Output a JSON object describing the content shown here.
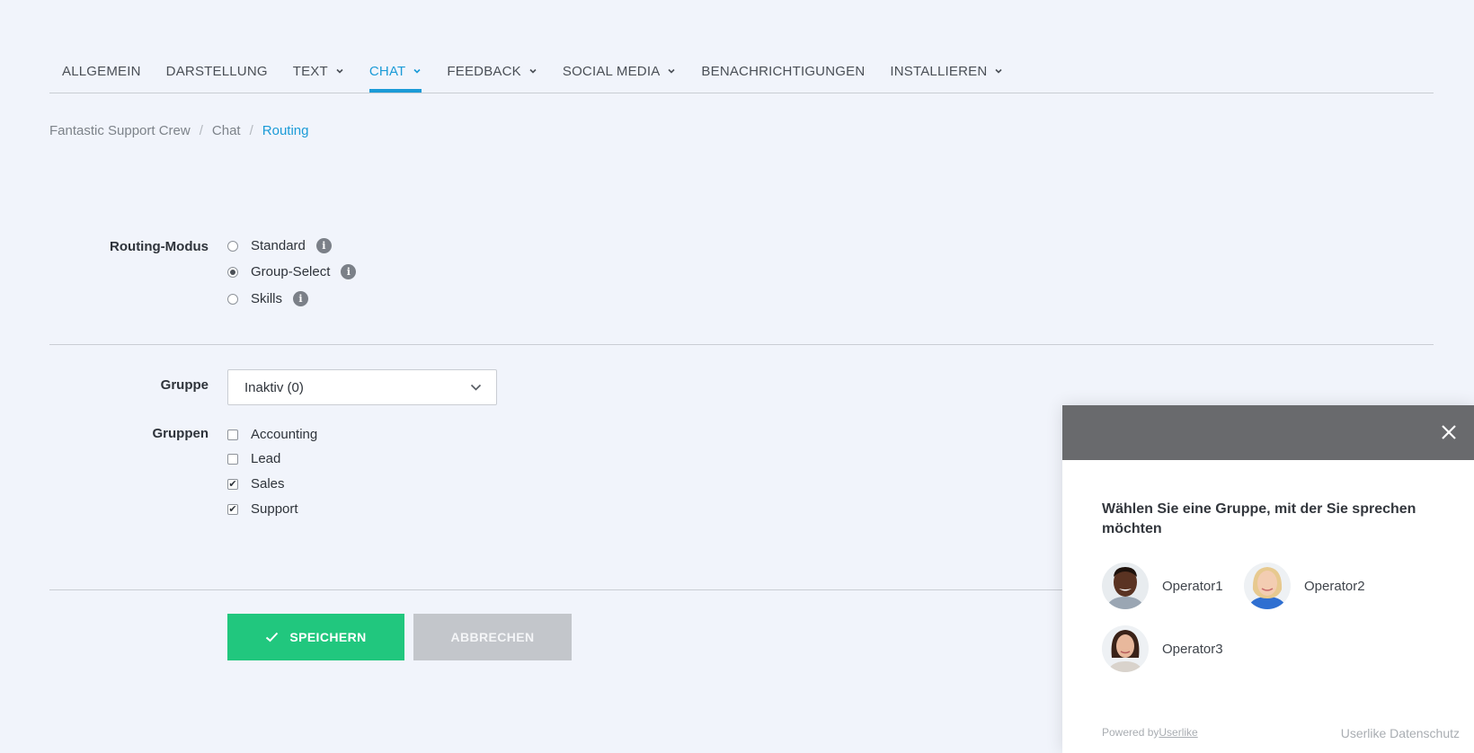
{
  "nav": {
    "items": [
      {
        "label": "ALLGEMEIN",
        "dropdown": false
      },
      {
        "label": "DARSTELLUNG",
        "dropdown": false
      },
      {
        "label": "TEXT",
        "dropdown": true
      },
      {
        "label": "CHAT",
        "dropdown": true,
        "active": true
      },
      {
        "label": "FEEDBACK",
        "dropdown": true
      },
      {
        "label": "SOCIAL MEDIA",
        "dropdown": true
      },
      {
        "label": "BENACHRICHTIGUNGEN",
        "dropdown": false
      },
      {
        "label": "INSTALLIEREN",
        "dropdown": true
      }
    ]
  },
  "breadcrumb": {
    "items": [
      "Fantastic Support Crew",
      "Chat",
      "Routing"
    ],
    "separator": "/"
  },
  "routing": {
    "label": "Routing-Modus",
    "options": [
      {
        "label": "Standard",
        "selected": false
      },
      {
        "label": "Group-Select",
        "selected": true
      },
      {
        "label": "Skills",
        "selected": false
      }
    ],
    "info_glyph": "i"
  },
  "group": {
    "label": "Gruppe",
    "selected_value": "Inaktiv (0)"
  },
  "groups": {
    "label": "Gruppen",
    "items": [
      {
        "label": "Accounting",
        "checked": false
      },
      {
        "label": "Lead",
        "checked": false
      },
      {
        "label": "Sales",
        "checked": true
      },
      {
        "label": "Support",
        "checked": true
      }
    ]
  },
  "actions": {
    "save_label": "SPEICHERN",
    "cancel_label": "ABBRECHEN"
  },
  "widget": {
    "title": "Wählen Sie eine Gruppe, mit der Sie sprechen möchten",
    "operators": [
      "Operator1",
      "Operator2",
      "Operator3"
    ],
    "powered_by": "Powered by",
    "powered_link": "Userlike",
    "privacy": "Userlike Datenschutz"
  },
  "colors": {
    "accent": "#1b9bd7",
    "save": "#21c77e",
    "cancel": "#c3c6cb",
    "widget_header": "#696a6d",
    "background": "#f1f4fb"
  }
}
